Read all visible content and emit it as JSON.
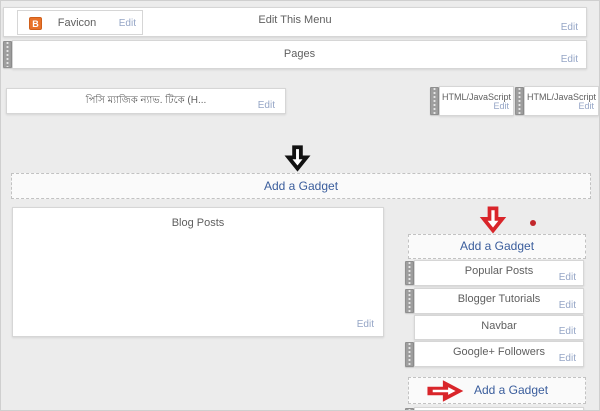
{
  "colors": {
    "page_background": "#ececec",
    "add_gadget_blue": "#3a5d9c",
    "edit_link_blue_gray": "#95a5c6",
    "annotation_red": "#d9252a",
    "annotation_black": "#111111",
    "favicon_orange": "#e8722a"
  },
  "header_row": {
    "favicon_widget": {
      "title": "Favicon",
      "edit_label": "Edit",
      "icon": "blogger-b-icon"
    },
    "menu_title": "Edit This Menu",
    "edit_label": "Edit"
  },
  "pages_row": {
    "title": "Pages",
    "edit_label": "Edit"
  },
  "nav_widget": {
    "title": "পিসি ম্যাজিক ন্যাভ. টিকে (H...",
    "edit_label": "Edit"
  },
  "html_widget_1": {
    "title": "HTML/JavaScript",
    "edit_label": "Edit"
  },
  "html_widget_2": {
    "title": "HTML/JavaScript",
    "edit_label": "Edit"
  },
  "main_section": {
    "add_gadget_label": "Add a Gadget"
  },
  "blog_posts_widget": {
    "title": "Blog Posts",
    "edit_label": "Edit"
  },
  "sidebar": {
    "add_gadget_top_label": "Add a Gadget",
    "widgets": [
      {
        "title": "Popular Posts",
        "edit_label": "Edit"
      },
      {
        "title": "Blogger Tutorials",
        "edit_label": "Edit"
      },
      {
        "title": "Navbar",
        "edit_label": "Edit"
      },
      {
        "title": "Google+ Followers",
        "edit_label": "Edit"
      }
    ],
    "add_gadget_bottom_label": "Add a Gadget"
  }
}
